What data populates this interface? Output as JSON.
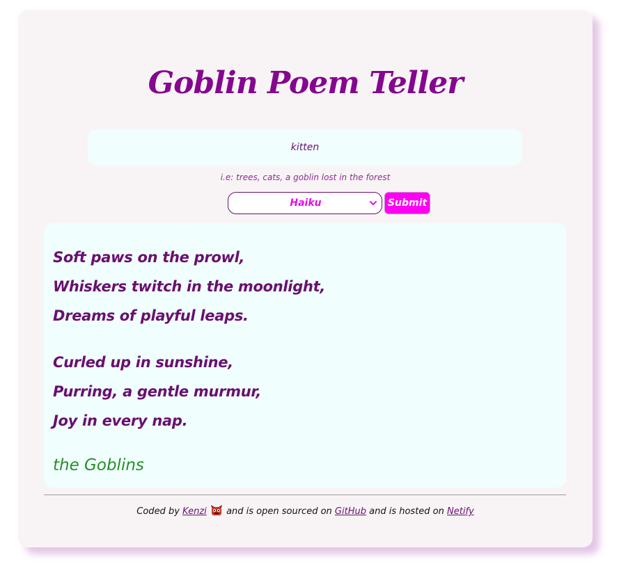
{
  "app": {
    "title": "Goblin Poem Teller"
  },
  "search": {
    "value": "kitten",
    "hint": "i.e: trees, cats, a goblin lost in the forest"
  },
  "poem_type": {
    "selected": "Haiku",
    "icon": "chevron-down-icon"
  },
  "submit": {
    "label": "Submit"
  },
  "poem": {
    "lines": [
      "Soft paws on the prowl,",
      "Whiskers twitch in the moonlight,",
      "Dreams of playful leaps.",
      "Curled up in sunshine,",
      "Purring, a gentle murmur,",
      "Joy in every nap."
    ],
    "signature": "the Goblins"
  },
  "footer": {
    "text_1": "Coded by",
    "author_link": "Kenzi",
    "author_icon": "goblin-face-icon",
    "text_2": "and is open sourced on",
    "github_link": "GitHub",
    "text_3": "and is hosted on",
    "host_link": "Netify"
  },
  "colors": {
    "title": "#85068f",
    "accent": "#ff00f5",
    "poem_text": "#6a0f6f",
    "signature": "#268f25",
    "panel_bg": "#f0fffe",
    "card_bg": "#f8f4f6"
  }
}
